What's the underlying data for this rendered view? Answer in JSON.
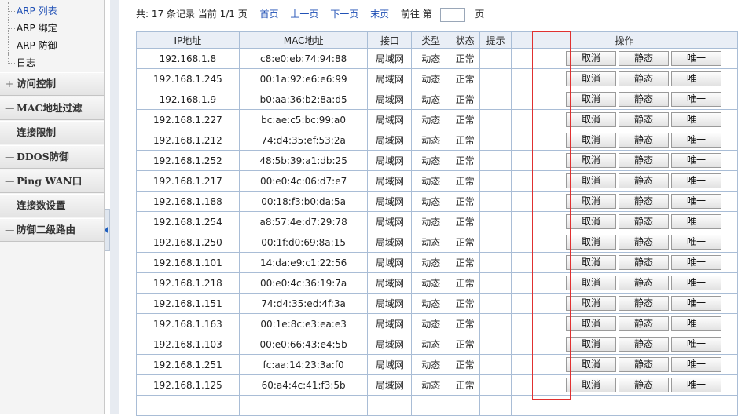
{
  "sidebar": {
    "sub_items": [
      {
        "label": "ARP 列表",
        "active": true
      },
      {
        "label": "ARP 绑定",
        "active": false
      },
      {
        "label": "ARP 防御",
        "active": false
      },
      {
        "label": "日志",
        "active": false
      }
    ],
    "menu_items": [
      {
        "label": "访问控制",
        "icon": "plus-icon"
      },
      {
        "label": "MAC地址过滤",
        "icon": "minus-icon"
      },
      {
        "label": "连接限制",
        "icon": "minus-icon"
      },
      {
        "label": "DDOS防御",
        "icon": "minus-icon"
      },
      {
        "label": "Ping WAN口",
        "icon": "minus-icon"
      },
      {
        "label": "连接数设置",
        "icon": "minus-icon"
      },
      {
        "label": "防御二级路由",
        "icon": "minus-icon"
      }
    ]
  },
  "pager": {
    "summary": "共: 17 条记录 当前 1/1 页",
    "first": "首页",
    "prev": "上一页",
    "next": "下一页",
    "last": "末页",
    "goto_prefix": "前往 第",
    "goto_value": "",
    "goto_suffix": "页"
  },
  "table": {
    "headers": {
      "ip": "IP地址",
      "mac": "MAC地址",
      "iface": "接口",
      "type": "类型",
      "status": "状态",
      "hint": "提示",
      "ops": "操作"
    },
    "buttons": {
      "cancel": "取消",
      "static": "静态",
      "unique": "唯一"
    },
    "rows": [
      {
        "ip": "192.168.1.8",
        "mac": "c8:e0:eb:74:94:88",
        "iface": "局域网",
        "type": "动态",
        "status": "正常",
        "hint": ""
      },
      {
        "ip": "192.168.1.245",
        "mac": "00:1a:92:e6:e6:99",
        "iface": "局域网",
        "type": "动态",
        "status": "正常",
        "hint": ""
      },
      {
        "ip": "192.168.1.9",
        "mac": "b0:aa:36:b2:8a:d5",
        "iface": "局域网",
        "type": "动态",
        "status": "正常",
        "hint": ""
      },
      {
        "ip": "192.168.1.227",
        "mac": "bc:ae:c5:bc:99:a0",
        "iface": "局域网",
        "type": "动态",
        "status": "正常",
        "hint": ""
      },
      {
        "ip": "192.168.1.212",
        "mac": "74:d4:35:ef:53:2a",
        "iface": "局域网",
        "type": "动态",
        "status": "正常",
        "hint": ""
      },
      {
        "ip": "192.168.1.252",
        "mac": "48:5b:39:a1:db:25",
        "iface": "局域网",
        "type": "动态",
        "status": "正常",
        "hint": ""
      },
      {
        "ip": "192.168.1.217",
        "mac": "00:e0:4c:06:d7:e7",
        "iface": "局域网",
        "type": "动态",
        "status": "正常",
        "hint": ""
      },
      {
        "ip": "192.168.1.188",
        "mac": "00:18:f3:b0:da:5a",
        "iface": "局域网",
        "type": "动态",
        "status": "正常",
        "hint": ""
      },
      {
        "ip": "192.168.1.254",
        "mac": "a8:57:4e:d7:29:78",
        "iface": "局域网",
        "type": "动态",
        "status": "正常",
        "hint": ""
      },
      {
        "ip": "192.168.1.250",
        "mac": "00:1f:d0:69:8a:15",
        "iface": "局域网",
        "type": "动态",
        "status": "正常",
        "hint": ""
      },
      {
        "ip": "192.168.1.101",
        "mac": "14:da:e9:c1:22:56",
        "iface": "局域网",
        "type": "动态",
        "status": "正常",
        "hint": ""
      },
      {
        "ip": "192.168.1.218",
        "mac": "00:e0:4c:36:19:7a",
        "iface": "局域网",
        "type": "动态",
        "status": "正常",
        "hint": ""
      },
      {
        "ip": "192.168.1.151",
        "mac": "74:d4:35:ed:4f:3a",
        "iface": "局域网",
        "type": "动态",
        "status": "正常",
        "hint": ""
      },
      {
        "ip": "192.168.1.163",
        "mac": "00:1e:8c:e3:ea:e3",
        "iface": "局域网",
        "type": "动态",
        "status": "正常",
        "hint": ""
      },
      {
        "ip": "192.168.1.103",
        "mac": "00:e0:66:43:e4:5b",
        "iface": "局域网",
        "type": "动态",
        "status": "正常",
        "hint": ""
      },
      {
        "ip": "192.168.1.251",
        "mac": "fc:aa:14:23:3a:f0",
        "iface": "局域网",
        "type": "动态",
        "status": "正常",
        "hint": ""
      },
      {
        "ip": "192.168.1.125",
        "mac": "60:a4:4c:41:f3:5b",
        "iface": "局域网",
        "type": "动态",
        "status": "正常",
        "hint": ""
      }
    ]
  },
  "colors": {
    "link": "#1f4fb5",
    "table_border": "#a9bdd6",
    "header_bg": "#e9eef6",
    "highlight_border": "#e03030"
  }
}
